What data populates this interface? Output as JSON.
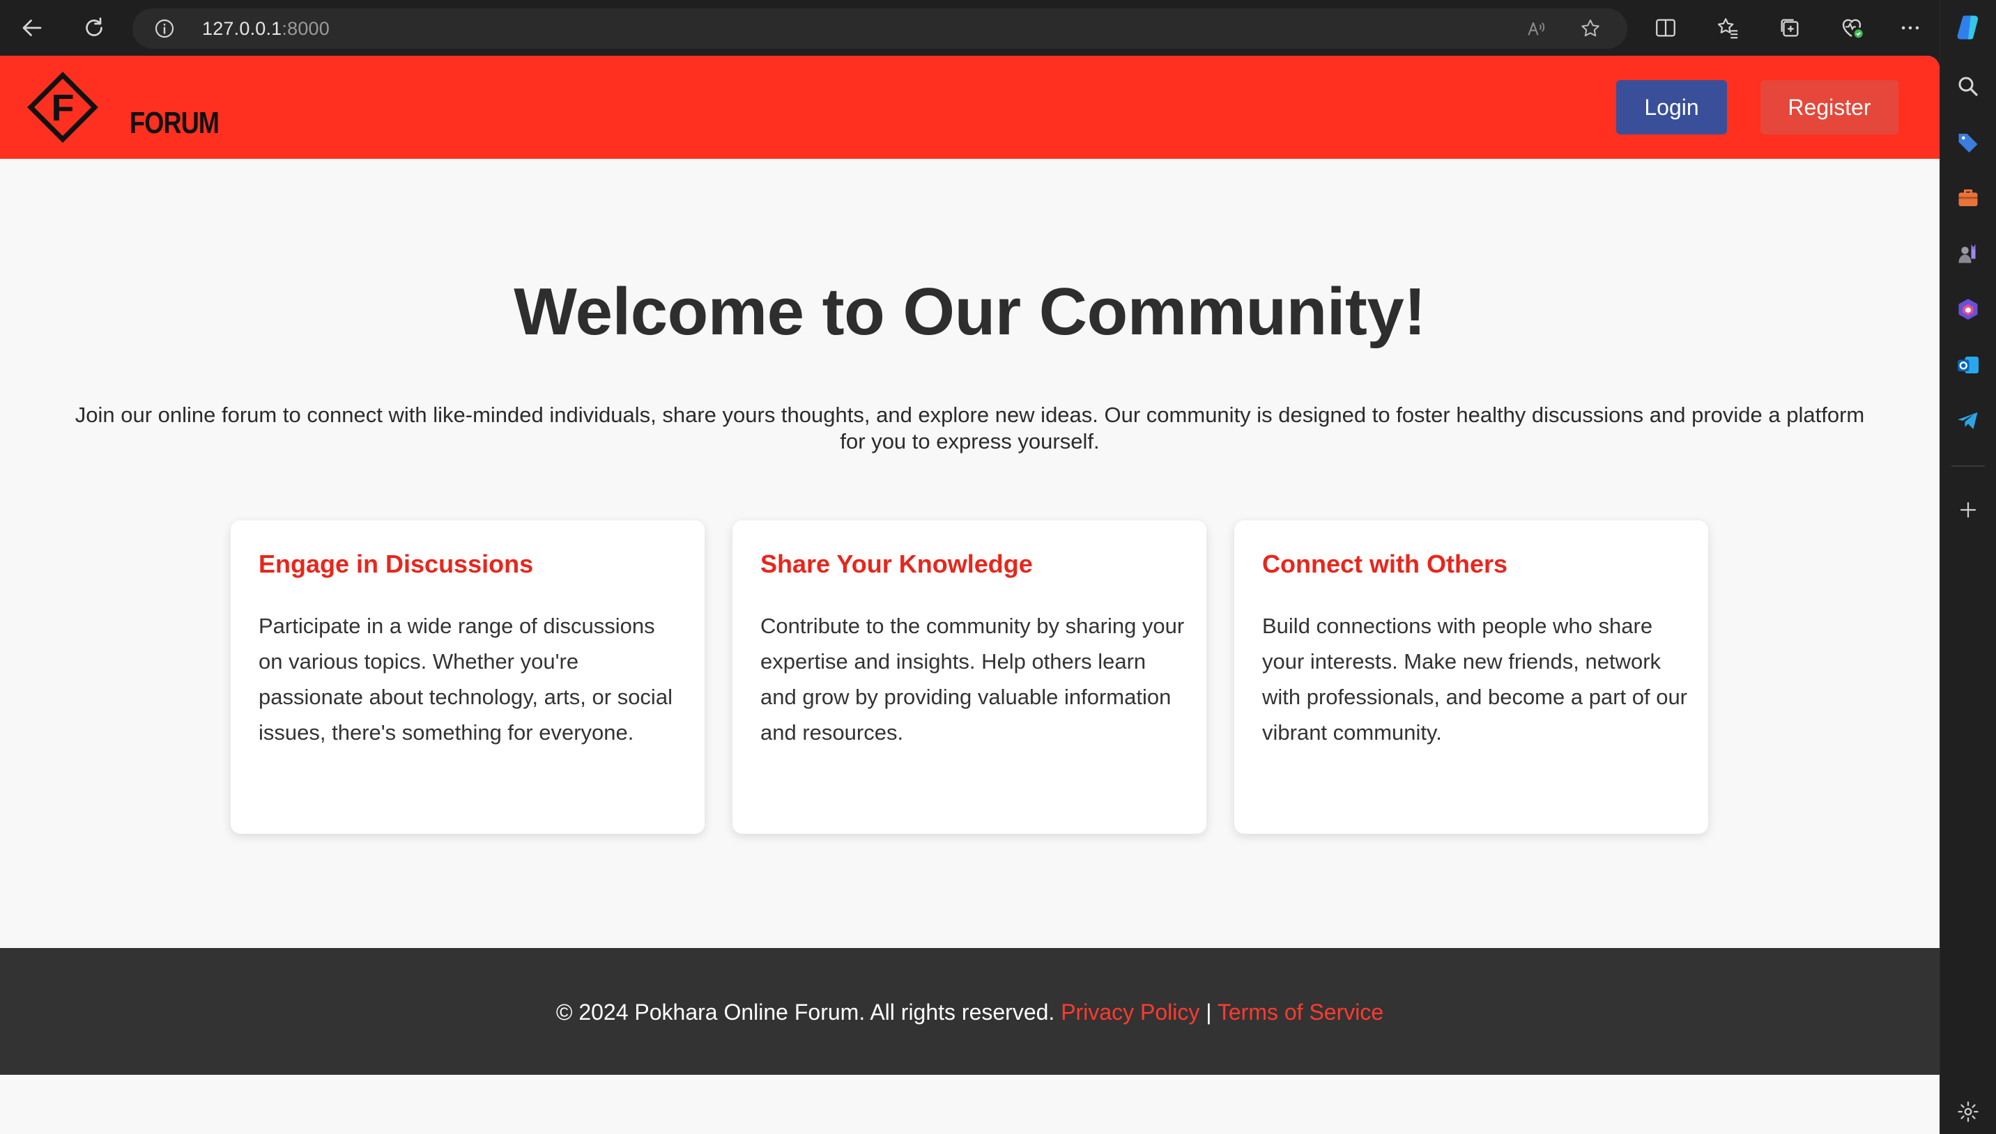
{
  "browser": {
    "url_host": "127.0.0.1",
    "url_port": ":8000"
  },
  "header": {
    "logo_text": "FORUM",
    "login_label": "Login",
    "register_label": "Register",
    "colors": {
      "header_bg": "#ff3020",
      "login_bg": "#3a4f9a",
      "register_bg": "#e5483b"
    }
  },
  "hero": {
    "title": "Welcome to Our Community!",
    "description_line1": "Join our online forum to connect with like-minded individuals, share yours thoughts, and explore new ideas. Our community is designed to foster healthy discussions and provide a platform",
    "description_line2": "for you to express yourself."
  },
  "cards": [
    {
      "title": "Engage in Discussions",
      "body": "Participate in a wide range of discussions on various topics. Whether you're passionate about technology, arts, or social issues, there's something for everyone."
    },
    {
      "title": "Share Your Knowledge",
      "body": "Contribute to the community by sharing your expertise and insights. Help others learn and grow by providing valuable information and resources."
    },
    {
      "title": "Connect with Others",
      "body": "Build connections with people who share your interests. Make new friends, network with professionals, and become a part of our vibrant community."
    }
  ],
  "footer": {
    "copyright": "© 2024 Pokhara Online Forum. All rights reserved. ",
    "privacy_link": "Privacy Policy",
    "separator": " | ",
    "terms_link": "Terms of Service"
  }
}
